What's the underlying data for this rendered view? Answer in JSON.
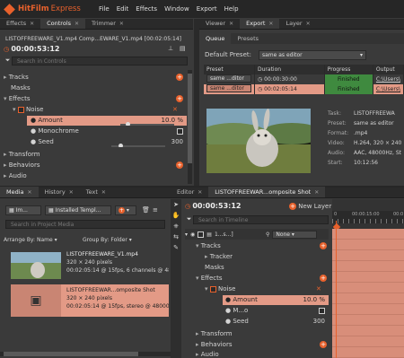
{
  "app": {
    "name1": "HitFilm",
    "name2": "Express"
  },
  "menu": [
    "File",
    "Edit",
    "Effects",
    "Window",
    "Export",
    "Help"
  ],
  "controls_panel": {
    "tabs": [
      {
        "label": "Effects"
      },
      {
        "label": "Controls"
      },
      {
        "label": "Trimmer"
      }
    ],
    "clip_title": "LISTOFFREEWARE_V1.mp4 Comp...EWARE_V1.mp4 [00:02:05:14]",
    "timecode": "00:00:53:12",
    "search_placeholder": "Search in Controls",
    "tree": {
      "tracks": "Tracks",
      "masks": "Masks",
      "effects": "Effects",
      "noise": "Noise",
      "amount": "Amount",
      "amount_val": "10.0 %",
      "amount_frac": 0.1,
      "mono": "Monochrome",
      "seed": "Seed",
      "seed_val": "300",
      "transform": "Transform",
      "behaviors": "Behaviors",
      "audio": "Audio"
    }
  },
  "viewer_panel": {
    "tabs": [
      {
        "label": "Viewer"
      },
      {
        "label": "Export"
      },
      {
        "label": "Layer"
      }
    ],
    "subtabs": [
      "Queue",
      "Presets"
    ],
    "default_preset_label": "Default Preset:",
    "default_preset_value": "same as editor",
    "headers": [
      "Preset",
      "Duration",
      "Progress",
      "Output"
    ],
    "rows": [
      {
        "preset": "same ...ditor",
        "duration": "00:00:30:00",
        "progress": "Finished",
        "output": "C:\\Users\\"
      },
      {
        "preset": "same ...ditor",
        "duration": "00:02:05:14",
        "progress": "Finished",
        "output": "C:\\Users\\"
      }
    ],
    "info": {
      "labels": [
        "Task:",
        "Preset:",
        "Format:",
        "Video:",
        "Audio:",
        "Start:"
      ],
      "values": [
        "LISTOFFREEWA",
        "same as editor",
        ".mp4",
        "H.264, 320 × 240",
        "AAC, 48000Hz, St",
        "10:12:56"
      ]
    }
  },
  "media_panel": {
    "tabs": [
      {
        "label": "Media"
      },
      {
        "label": "History"
      },
      {
        "label": "Text"
      }
    ],
    "import_label": "Im...",
    "installed_label": "Installed Templ...",
    "search_placeholder": "Search in Project Media",
    "arrange_label": "Arrange By: Name",
    "group_label": "Group By: Folder",
    "items": [
      {
        "name": "LISTOFFREEWARE_V1.mp4",
        "line1": "320 × 240 pixels",
        "line2": "00:02:05:14 @ 15fps, 6 channels @ 48..."
      },
      {
        "name": "LISTOFFREEWAR...omposite Shot",
        "line1": "320 × 240 pixels",
        "line2": "00:02:05:14 @ 15fps, stereo @ 48000..."
      }
    ]
  },
  "editor_panel": {
    "tabs": [
      {
        "label": "Editor"
      },
      {
        "label": "LISTOFFREEWAR...omposite Shot"
      }
    ],
    "timecode": "00:00:53:12",
    "new_layer": "New Layer",
    "search_placeholder": "Search in Timeline",
    "layer_name": "1...s...]",
    "blend": "None",
    "ruler": [
      "0",
      "00:00:15:00",
      "00:0"
    ],
    "tree": {
      "tracks": "Tracks",
      "tracker": "Tracker",
      "masks": "Masks",
      "effects": "Effects",
      "noise": "Noise",
      "amount": "Amount",
      "amount_val": "10.0 %",
      "mono": "M...o",
      "seed": "Seed",
      "seed_val": "300",
      "transform": "Transform",
      "behaviors": "Behaviors",
      "audio": "Audio"
    }
  },
  "colors": {
    "accent": "#e8612c",
    "selected": "#e39a86",
    "finished": "#3f8a3f"
  }
}
